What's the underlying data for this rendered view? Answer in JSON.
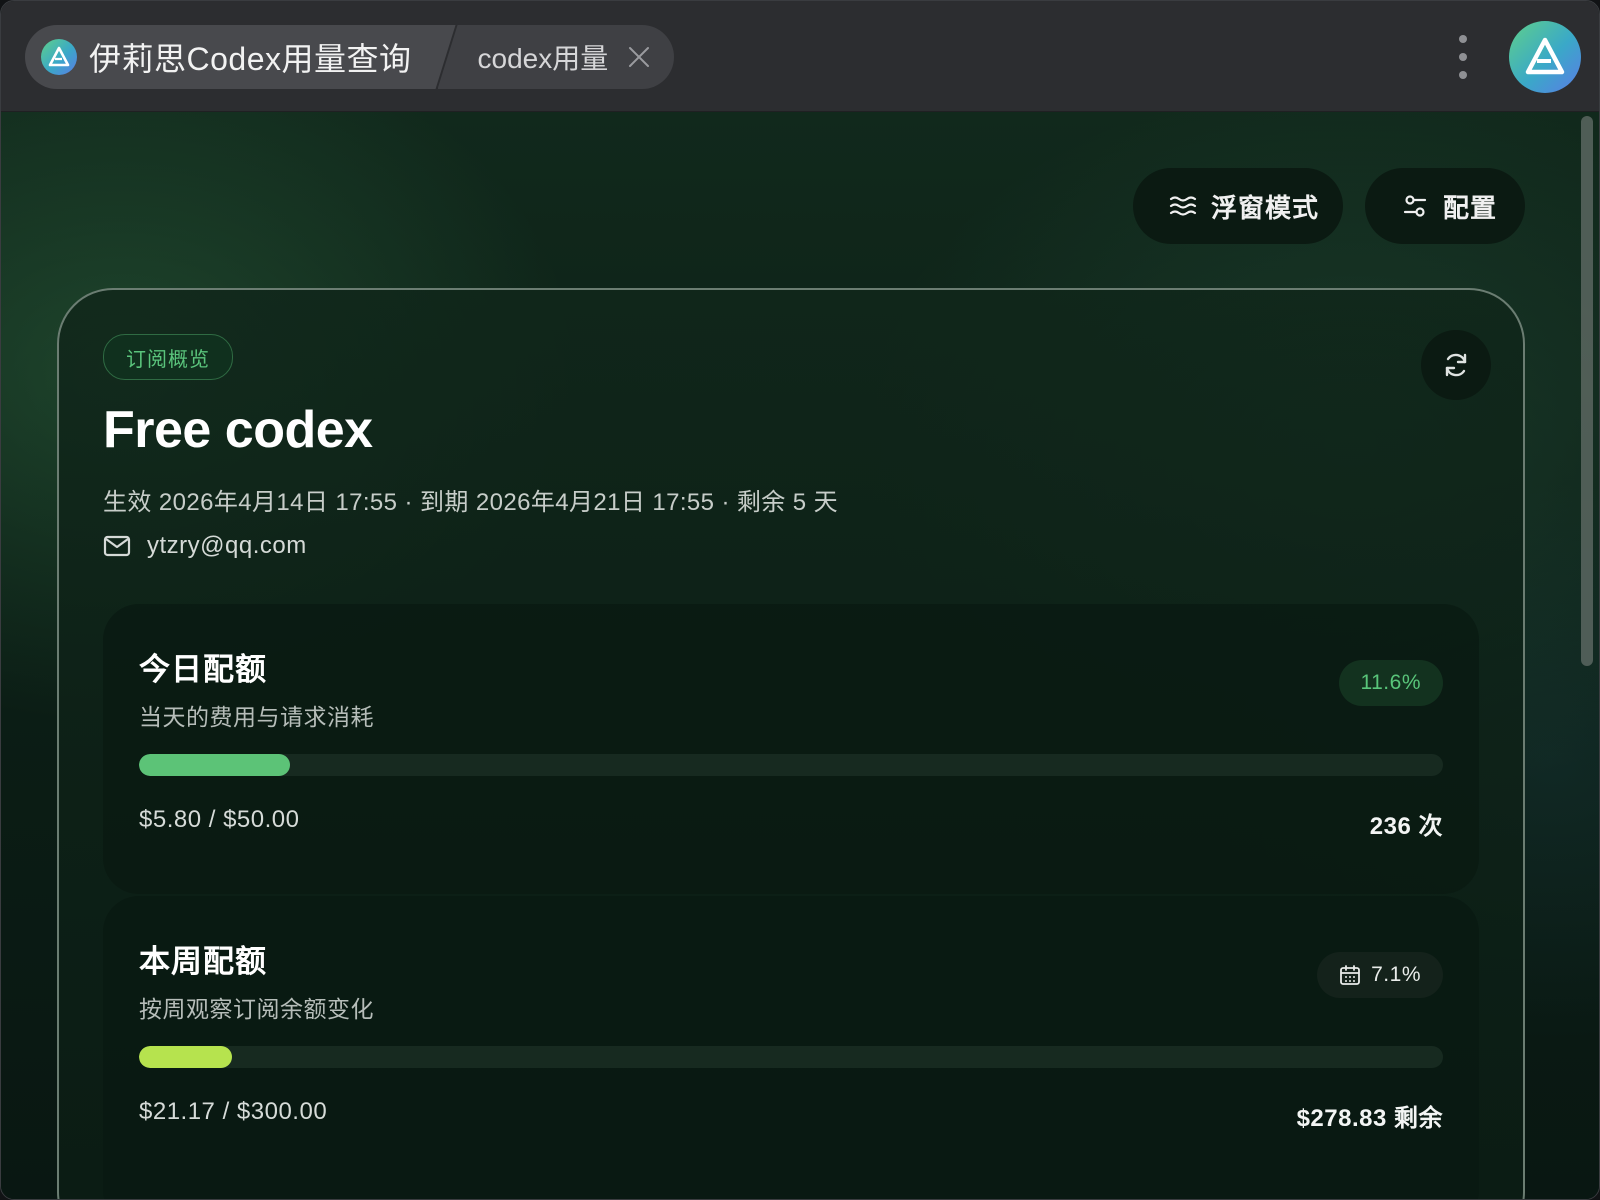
{
  "window": {
    "tab_main_label": "伊莉思Codex用量查询",
    "tab_second_label": "codex用量"
  },
  "toolbar": {
    "float_mode_label": "浮窗模式",
    "config_label": "配置"
  },
  "subscription": {
    "chip_label": "订阅概览",
    "plan_name": "Free codex",
    "dates_line": "生效 2026年4月14日 17:55 · 到期 2026年4月21日 17:55 · 剩余 5 天",
    "email": "ytzry@qq.com"
  },
  "daily": {
    "title": "今日配额",
    "subtitle": "当天的费用与请求消耗",
    "percent_label": "11.6%",
    "usage_fraction": 0.116,
    "amount": "$5.80 / $50.00",
    "right_value": "236 次",
    "bar_color": "#5cc377"
  },
  "weekly": {
    "title": "本周配额",
    "subtitle": "按周观察订阅余额变化",
    "percent_label": "7.1%",
    "usage_fraction": 0.071,
    "amount": "$21.17 / $300.00",
    "right_value": "$278.83 剩余",
    "bar_color": "#b6e34e"
  },
  "colors": {
    "accent_green": "#59c57a",
    "brand_gradient_start": "#5fd08a",
    "brand_gradient_end": "#5b7ce6"
  },
  "icons": {
    "app_logo": "app-logo-icon",
    "close": "close-icon",
    "more": "more-vertical-icon",
    "float_mode": "waves-icon",
    "config": "sliders-icon",
    "refresh": "refresh-icon",
    "email": "mail-icon",
    "calendar": "calendar-icon"
  }
}
